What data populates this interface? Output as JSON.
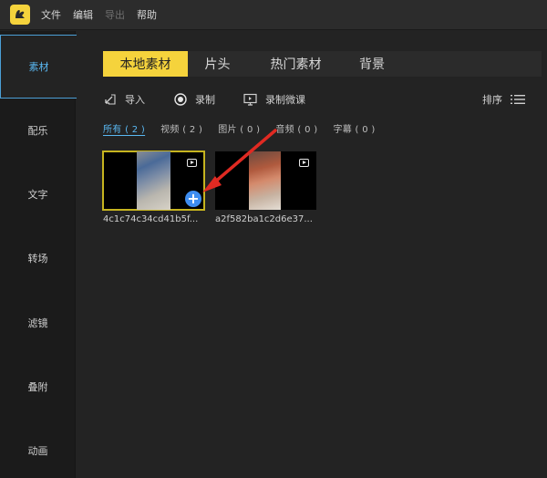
{
  "menu": {
    "items": [
      {
        "label": "文件",
        "enabled": true
      },
      {
        "label": "编辑",
        "enabled": true
      },
      {
        "label": "导出",
        "enabled": false
      },
      {
        "label": "帮助",
        "enabled": true
      }
    ]
  },
  "sidebar": {
    "active_index": 0,
    "items": [
      {
        "label": "素材"
      },
      {
        "label": "配乐"
      },
      {
        "label": "文字"
      },
      {
        "label": "转场"
      },
      {
        "label": "滤镜"
      },
      {
        "label": "叠附"
      },
      {
        "label": "动画"
      }
    ]
  },
  "tabs": {
    "active_index": 0,
    "items": [
      {
        "label": "本地素材"
      },
      {
        "label": "片头"
      },
      {
        "label": "热门素材"
      },
      {
        "label": "背景"
      }
    ]
  },
  "toolbar": {
    "import_label": "导入",
    "record_label": "录制",
    "record_lesson_label": "录制微课",
    "sort_label": "排序"
  },
  "filters": {
    "active_index": 0,
    "items": [
      {
        "label": "所有 ( 2 )"
      },
      {
        "label": "视频 ( 2 )"
      },
      {
        "label": "图片 ( 0 )"
      },
      {
        "label": "音频 ( 0 )"
      },
      {
        "label": "字幕 ( 0 )"
      }
    ]
  },
  "media": [
    {
      "filename": "4c1c74c34cd41b5f...",
      "selected": true,
      "add_label": "+"
    },
    {
      "filename": "a2f582ba1c2d6e37...",
      "selected": false
    }
  ],
  "colors": {
    "accent_yellow": "#f5d33c",
    "accent_blue": "#5ab8f2",
    "annotation_red": "#e02a22",
    "add_button": "#3e8df0"
  }
}
